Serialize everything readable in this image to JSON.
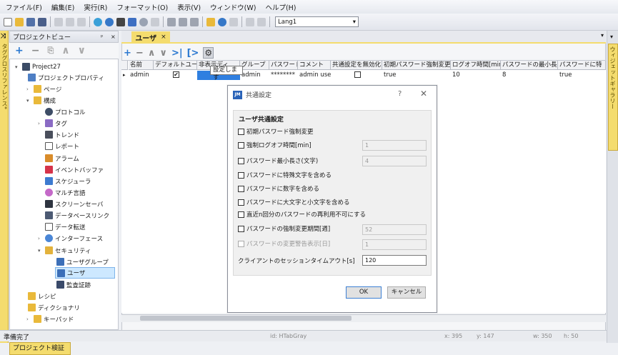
{
  "menu": [
    "ファイル(F)",
    "編集(E)",
    "実行(R)",
    "フォーマット(O)",
    "表示(V)",
    "ウィンドウ(W)",
    "ヘルプ(H)"
  ],
  "toolbar": {
    "lang_value": "Lang1"
  },
  "side": {
    "left_strip": "タググロスリファレンス*",
    "right_strip": "ウィジェットギャラリー"
  },
  "project_view": {
    "title": "プロジェクトビュー",
    "pin": "ᵖ",
    "close": "×",
    "items": [
      {
        "label": "Project27"
      },
      {
        "label": "プロジェクトプロパティ"
      },
      {
        "label": "ページ"
      },
      {
        "label": "構成"
      },
      {
        "label": "プロトコル"
      },
      {
        "label": "タグ"
      },
      {
        "label": "トレンド"
      },
      {
        "label": "レポート"
      },
      {
        "label": "アラーム"
      },
      {
        "label": "イベントバッファ"
      },
      {
        "label": "スケジューラ"
      },
      {
        "label": "マルチ言語"
      },
      {
        "label": "スクリーンセーバ"
      },
      {
        "label": "データベースリンク"
      },
      {
        "label": "データ転送"
      },
      {
        "label": "インターフェース"
      },
      {
        "label": "セキュリティ"
      },
      {
        "label": "ユーザグループ"
      },
      {
        "label": "ユーザ"
      },
      {
        "label": "監査証跡"
      },
      {
        "label": "レシピ"
      },
      {
        "label": "ディクショナリ"
      },
      {
        "label": "キーパッド"
      }
    ]
  },
  "editor": {
    "tab_label": "ユーザ",
    "tab_close": "×",
    "tooltip": "設定します",
    "columns": [
      "名前",
      "デフォルトユーザ",
      "非表示ディ",
      "グループ",
      "パスワード",
      "コメント",
      "共通設定を無効化",
      "初期パスワード強制変更",
      "ログオフ時間[min]",
      "パスワードの最小長さ",
      "パスワードに特"
    ],
    "row": {
      "name": "admin",
      "default_user": true,
      "hidden": "",
      "group": "admin",
      "password": "********",
      "comment": "admin user",
      "disable_common": false,
      "force_change": "true",
      "logoff": "10",
      "min_length": "8",
      "special": "true"
    }
  },
  "dialog": {
    "title": "共通設定",
    "help": "?",
    "close": "✕",
    "group_title": "ユーザ共通設定",
    "options": [
      {
        "label": "初期パスワード強制変更",
        "value": ""
      },
      {
        "label": "強制ログオフ時間[min]",
        "value": "1"
      },
      {
        "label": "パスワード最小長さ(文字)",
        "value": "4"
      },
      {
        "label": "パスワードに特殊文字を含める",
        "value": ""
      },
      {
        "label": "パスワードに数字を含める",
        "value": ""
      },
      {
        "label": "パスワードに大文字と小文字を含める",
        "value": ""
      },
      {
        "label": "直近n回分のパスワードの再利用不可にする",
        "value": ""
      },
      {
        "label": "パスワードの強制変更期間[週]",
        "value": "52"
      },
      {
        "label": "パスワードの変更警告表示[日]",
        "value": "1"
      }
    ],
    "timeout_label": "クライアントのセッションタイムアウト[s]",
    "timeout_value": "120",
    "ok_label": "OK",
    "cancel_label": "キャンセル"
  },
  "status": {
    "text": "準備完了",
    "id": "id:  HTabGray",
    "x": "x: 395",
    "y": "y: 147",
    "w": "w: 350",
    "h": "h: 50",
    "bottom_tab": "プロジェクト検証"
  }
}
